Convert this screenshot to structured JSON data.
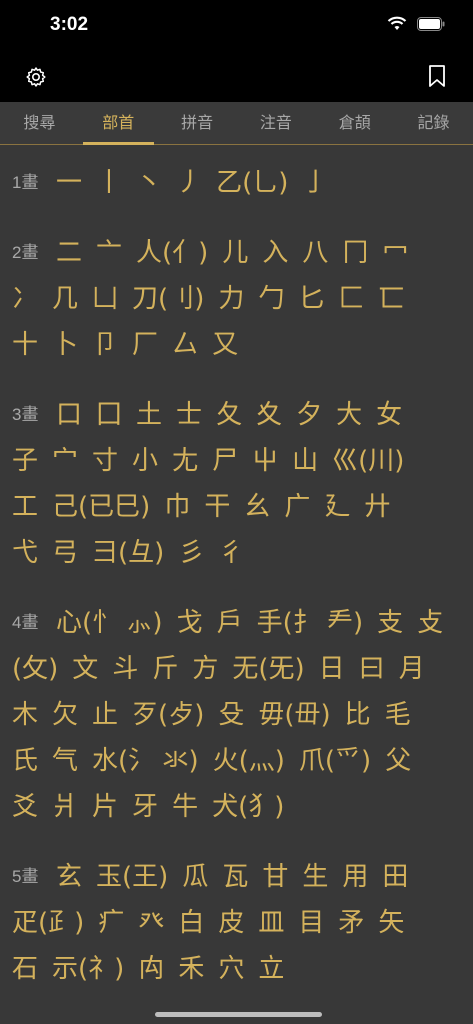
{
  "status": {
    "time": "3:02"
  },
  "tabs": [
    {
      "label": "搜尋",
      "active": false
    },
    {
      "label": "部首",
      "active": true
    },
    {
      "label": "拼音",
      "active": false
    },
    {
      "label": "注音",
      "active": false
    },
    {
      "label": "倉頡",
      "active": false
    },
    {
      "label": "記錄",
      "active": false
    }
  ],
  "groups": [
    {
      "label": "1畫",
      "rows": [
        [
          "一",
          "丨",
          "丶",
          "丿",
          "乙(乚)",
          "亅"
        ]
      ]
    },
    {
      "label": "2畫",
      "rows": [
        [
          "二",
          "亠",
          "人(亻)",
          "儿",
          "入",
          "八",
          "冂",
          "冖"
        ],
        [
          "冫",
          "几",
          "凵",
          "刀(刂)",
          "力",
          "勹",
          "匕",
          "匚",
          "匸"
        ],
        [
          "十",
          "卜",
          "卩",
          "厂",
          "厶",
          "又"
        ]
      ]
    },
    {
      "label": "3畫",
      "rows": [
        [
          "口",
          "囗",
          "土",
          "士",
          "夂",
          "夊",
          "夕",
          "大",
          "女"
        ],
        [
          "子",
          "宀",
          "寸",
          "小",
          "尢",
          "尸",
          "屮",
          "山",
          "巛(川)"
        ],
        [
          "工",
          "己(已巳)",
          "巾",
          "干",
          "幺",
          "广",
          "廴",
          "廾"
        ],
        [
          "弋",
          "弓",
          "彐(彑)",
          "彡",
          "彳"
        ]
      ]
    },
    {
      "label": "4畫",
      "rows": [
        [
          "心(忄 ⺗)",
          "戈",
          "戶",
          "手(扌 龵)",
          "支",
          "攴"
        ],
        [
          "(攵)",
          "文",
          "斗",
          "斤",
          "方",
          "无(旡)",
          "日",
          "曰",
          "月"
        ],
        [
          "木",
          "欠",
          "止",
          "歹(歺)",
          "殳",
          "毋(毌)",
          "比",
          "毛"
        ],
        [
          "氏",
          "气",
          "水(氵 氺)",
          "火(灬)",
          "爪(爫)",
          "父"
        ],
        [
          "爻",
          "爿",
          "片",
          "牙",
          "牛",
          "犬(犭)"
        ]
      ]
    },
    {
      "label": "5畫",
      "rows": [
        [
          "玄",
          "玉(王)",
          "瓜",
          "瓦",
          "甘",
          "生",
          "用",
          "田"
        ],
        [
          "疋(⺪)",
          "疒",
          "癶",
          "白",
          "皮",
          "皿",
          "目",
          "矛",
          "矢"
        ],
        [
          "石",
          "示(礻)",
          "禸",
          "禾",
          "穴",
          "立"
        ]
      ]
    }
  ]
}
